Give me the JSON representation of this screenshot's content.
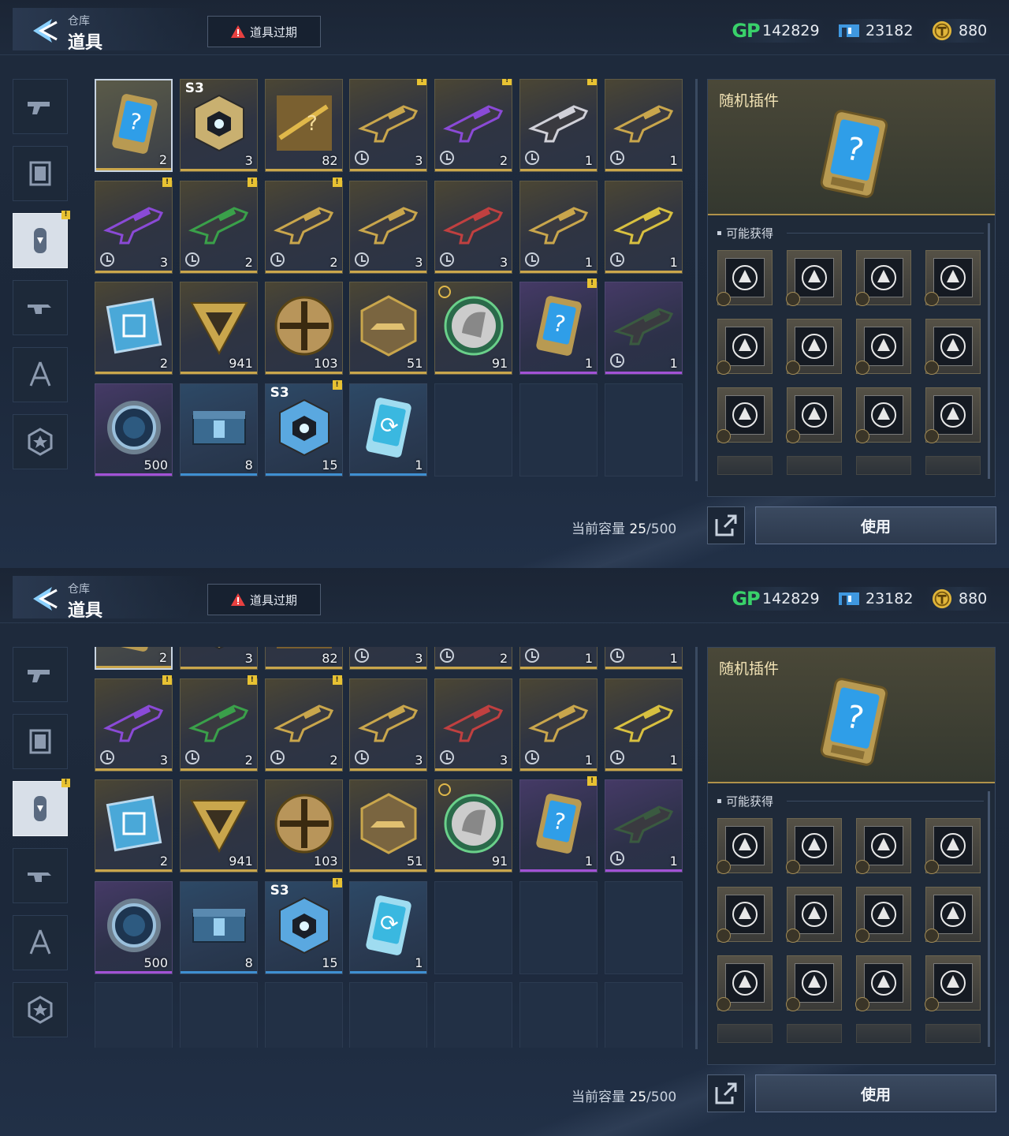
{
  "header": {
    "breadcrumb": "仓库",
    "title": "道具",
    "expire_button": "道具过期",
    "currencies": [
      {
        "name": "GP",
        "icon": "gp-icon",
        "value": "142829"
      },
      {
        "name": "ticket",
        "icon": "ticket-icon",
        "value": "23182"
      },
      {
        "name": "coin",
        "icon": "coin-icon",
        "value": "880"
      }
    ]
  },
  "sidebar": {
    "tabs": [
      {
        "icon": "pistol-icon"
      },
      {
        "icon": "frame-icon"
      },
      {
        "icon": "capsule-icon",
        "active": true,
        "badge": "!"
      },
      {
        "icon": "weapon-mod-icon"
      },
      {
        "icon": "compass-icon"
      },
      {
        "icon": "star-badge-icon"
      }
    ]
  },
  "screen1": {
    "rows": [
      [
        {
          "icon": "random-plugin-card-icon",
          "qty": "2",
          "rarity": "gold",
          "selected": true
        },
        {
          "icon": "gold-crystal-cube-icon",
          "qty": "3",
          "rarity": "gold",
          "season": "S3"
        },
        {
          "icon": "blueprint-sniper-icon",
          "qty": "82",
          "rarity": "gold"
        },
        {
          "icon": "gold-rifle-icon",
          "qty": "3",
          "rarity": "gold",
          "badge": "!",
          "clock": true
        },
        {
          "icon": "purple-smg-icon",
          "qty": "2",
          "rarity": "gold",
          "badge": "!",
          "clock": true
        },
        {
          "icon": "white-smg-icon",
          "qty": "1",
          "rarity": "gold",
          "badge": "!",
          "clock": true
        },
        {
          "icon": "crossbow-icon",
          "qty": "1",
          "rarity": "gold",
          "clock": true
        }
      ],
      [
        {
          "icon": "purple-rifle-icon",
          "qty": "3",
          "rarity": "gold",
          "badge": "!",
          "clock": true
        },
        {
          "icon": "green-shotgun-icon",
          "qty": "2",
          "rarity": "gold",
          "badge": "!",
          "clock": true
        },
        {
          "icon": "dual-blade-icon",
          "qty": "2",
          "rarity": "gold",
          "badge": "!",
          "clock": true
        },
        {
          "icon": "katana-icon",
          "qty": "3",
          "rarity": "gold",
          "clock": true
        },
        {
          "icon": "red-launcher-icon",
          "qty": "3",
          "rarity": "gold",
          "clock": true
        },
        {
          "icon": "gold-pistol-icon",
          "qty": "1",
          "rarity": "gold",
          "clock": true
        },
        {
          "icon": "yellow-rifle-icon",
          "qty": "1",
          "rarity": "gold",
          "clock": true
        }
      ],
      [
        {
          "icon": "chip-icon",
          "qty": "2",
          "rarity": "gold"
        },
        {
          "icon": "gold-triangle-icon",
          "qty": "941",
          "rarity": "gold"
        },
        {
          "icon": "gold-cross-medal-icon",
          "qty": "103",
          "rarity": "gold"
        },
        {
          "icon": "hex-weapon-token-icon",
          "qty": "51",
          "rarity": "gold"
        },
        {
          "icon": "helmet-medal-icon",
          "qty": "91",
          "rarity": "gold",
          "clock_top": true
        },
        {
          "icon": "random-plugin-card-icon",
          "qty": "1",
          "rarity": "purple",
          "badge": "!"
        },
        {
          "icon": "dark-rifle-icon",
          "qty": "1",
          "rarity": "purple",
          "clock": true
        }
      ],
      [
        {
          "icon": "blue-ring-icon",
          "qty": "500",
          "rarity": "purple"
        },
        {
          "icon": "blue-crate-icon",
          "qty": "8",
          "rarity": "blue"
        },
        {
          "icon": "blue-crystal-cube-icon",
          "qty": "15",
          "rarity": "blue",
          "season": "S3",
          "badge": "!"
        },
        {
          "icon": "refresh-card-icon",
          "qty": "1",
          "rarity": "blue"
        },
        {
          "empty": true
        },
        {
          "empty": true
        },
        {
          "empty": true
        }
      ]
    ]
  },
  "detail": {
    "name": "随机插件",
    "rewards_title": "可能获得",
    "rewards": [
      "ammo-plugin-icon",
      "no-target-plugin-icon",
      "hand-plugin-icon",
      "bust-plugin-icon",
      "magazine-plugin-icon",
      "crosshair-plugin-icon",
      "bullet-plugin-icon",
      "gun-plugin-icon",
      "shield-plugin-icon",
      "shield-up-plugin-icon",
      "dash-plugin-icon",
      "reload-plugin-icon"
    ],
    "use_button": "使用"
  },
  "capacity": {
    "label": "当前容量",
    "current": "25",
    "total": "/500"
  },
  "colors": {
    "gold": "#c9a64c",
    "purple": "#a252d6",
    "blue": "#3f8fd1",
    "gp": "#39d16a",
    "warning": "#e84040"
  }
}
